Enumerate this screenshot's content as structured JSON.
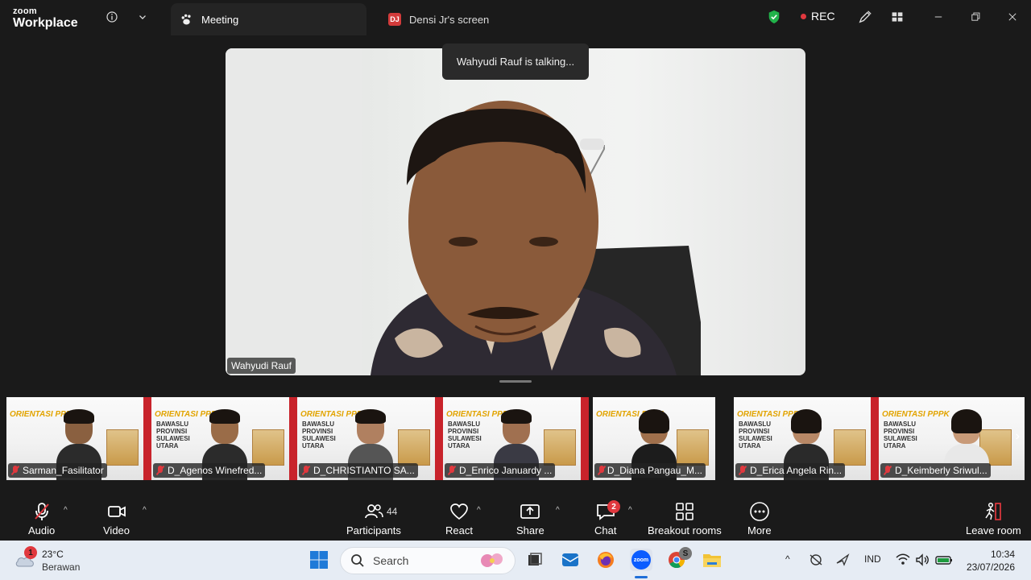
{
  "app": {
    "logo_small": "zoom",
    "logo_big": "Workplace"
  },
  "tabs": [
    {
      "label": "Meeting",
      "active": true
    },
    {
      "label": "Densi Jr's screen",
      "badge": "DJ"
    }
  ],
  "status": {
    "rec_label": "REC",
    "shield_color": "#21b24a"
  },
  "talking_notice": "Wahyudi Rauf is talking...",
  "main_speaker": {
    "name": "Wahyudi Rauf"
  },
  "filmstrip": {
    "banner_title": "ORIENTASI PPPK",
    "banner_org": "BAWASLU PROVINSI SULAWESI UTARA",
    "participants": [
      {
        "name": "Sarman_Fasilitator",
        "muted": true
      },
      {
        "name": "D_Agenos Winefred...",
        "muted": true
      },
      {
        "name": "D_CHRISTIANTO SA...",
        "muted": true
      },
      {
        "name": "D_Enrico Januardy ...",
        "muted": true
      },
      {
        "name": "D_Diana Pangau_M...",
        "muted": true
      },
      {
        "name": "D_Erica Angela Rin...",
        "muted": true
      },
      {
        "name": "D_Keimberly Sriwul...",
        "muted": true
      }
    ]
  },
  "toolbar": {
    "audio": "Audio",
    "video": "Video",
    "participants": "Participants",
    "participants_count": "44",
    "react": "React",
    "share": "Share",
    "chat": "Chat",
    "chat_badge": "2",
    "breakout": "Breakout rooms",
    "more": "More",
    "leave": "Leave room"
  },
  "taskbar": {
    "weather_temp": "23°C",
    "weather_desc": "Berawan",
    "weather_badge": "1",
    "search_placeholder": "Search",
    "chrome_badge": "S",
    "language": "IND",
    "time": "10:34",
    "date": "23/07/2026"
  }
}
